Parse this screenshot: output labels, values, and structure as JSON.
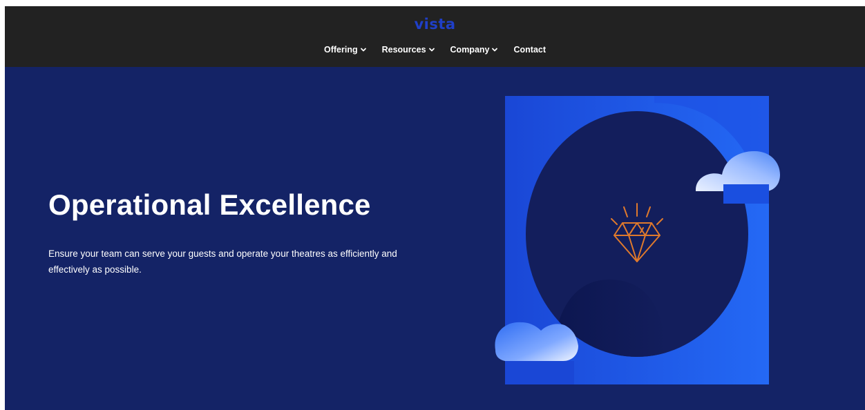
{
  "header": {
    "logo": "vista",
    "nav": [
      {
        "label": "Offering",
        "has_dropdown": true
      },
      {
        "label": "Resources",
        "has_dropdown": true
      },
      {
        "label": "Company",
        "has_dropdown": true
      },
      {
        "label": "Contact",
        "has_dropdown": false
      }
    ]
  },
  "hero": {
    "title": "Operational Excellence",
    "description": "Ensure your team can serve your guests and operate your theatres as efficiently and effectively as possible.",
    "illustration_icon": "diamond-icon"
  },
  "colors": {
    "header_bg": "#222222",
    "hero_bg": "#142366",
    "logo": "#1f3fc9",
    "panel_blue": "#1e5ff0",
    "circle": "#131e5c",
    "diamond": "#e07a2c"
  }
}
